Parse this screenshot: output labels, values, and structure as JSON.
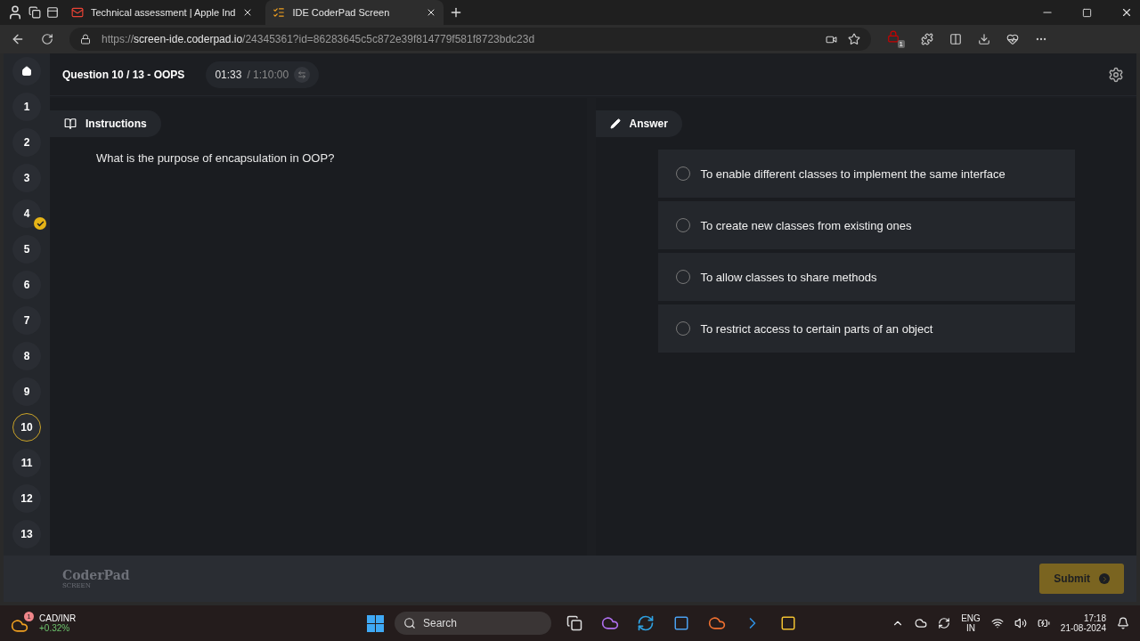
{
  "browser": {
    "tabs": [
      {
        "title": "Technical assessment | Apple Ind",
        "kind": "mail",
        "selected": false
      },
      {
        "title": "IDE CoderPad Screen",
        "kind": "app",
        "selected": true
      }
    ],
    "url": {
      "scheme": "https://",
      "host": "screen-ide.coderpad.io",
      "path": "/24345361?id=86283645c5c872e39f814779f581f8723bdc23d"
    },
    "extension_badge": "1"
  },
  "nav": {
    "items": [
      {
        "label": "1",
        "answered": false,
        "selected": false
      },
      {
        "label": "2",
        "answered": false,
        "selected": false
      },
      {
        "label": "3",
        "answered": false,
        "selected": false
      },
      {
        "label": "4",
        "answered": true,
        "selected": false
      },
      {
        "label": "5",
        "answered": false,
        "selected": false
      },
      {
        "label": "6",
        "answered": false,
        "selected": false
      },
      {
        "label": "7",
        "answered": false,
        "selected": false
      },
      {
        "label": "8",
        "answered": false,
        "selected": false
      },
      {
        "label": "9",
        "answered": false,
        "selected": false
      },
      {
        "label": "10",
        "answered": false,
        "selected": true
      },
      {
        "label": "11",
        "answered": false,
        "selected": false
      },
      {
        "label": "12",
        "answered": false,
        "selected": false
      },
      {
        "label": "13",
        "answered": false,
        "selected": false
      }
    ]
  },
  "header": {
    "title": "Question 10 / 13 - OOPS",
    "elapsed": "01:33",
    "total": "/ 1:10:00"
  },
  "instructions": {
    "tab": "Instructions",
    "question": "What is the purpose of encapsulation in OOP?"
  },
  "answer": {
    "tab": "Answer",
    "options": [
      {
        "text": "To enable different classes to implement the same interface",
        "selected": false
      },
      {
        "text": "To create new classes from existing ones",
        "selected": false
      },
      {
        "text": "To allow classes to share methods",
        "selected": false
      },
      {
        "text": "To restrict access to certain parts of an object",
        "selected": false
      }
    ]
  },
  "footer": {
    "logo": "CoderPad",
    "logo_sub": "SCREEN",
    "submit": "Submit"
  },
  "taskbar": {
    "widget": {
      "name": "CAD/INR",
      "change": "+0.32%",
      "badge": "1"
    },
    "search": {
      "placeholder": "Search"
    },
    "language": [
      "ENG",
      "IN"
    ],
    "time": "17:18",
    "date": "21-08-2024"
  }
}
